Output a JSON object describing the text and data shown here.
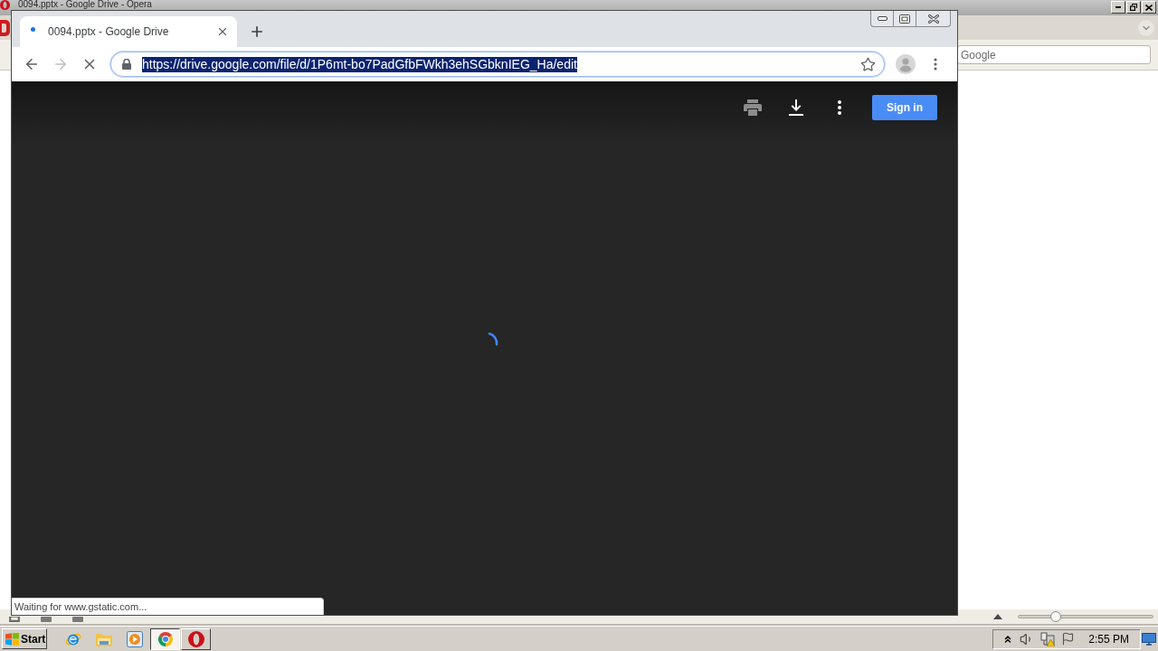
{
  "background_window": {
    "title": "0094.pptx - Google Drive - Opera",
    "search": {
      "placeholder": "Google"
    },
    "zoom": {
      "level": 0.28
    }
  },
  "browser": {
    "tabs": [
      {
        "title": "0094.pptx - Google Drive",
        "selected": true,
        "loading": true
      }
    ],
    "nav": [
      {
        "kind": "back",
        "disabled": false
      },
      {
        "kind": "forward",
        "disabled": true
      },
      {
        "kind": "stop",
        "disabled": false
      }
    ],
    "address_bar": {
      "url": "https://drive.google.com/file/d/1P6mt-bo7PadGfbFWkh3ehSGbknIEG_Ha/edit",
      "focused": true
    },
    "viewer": {
      "actions": [
        {
          "kind": "print",
          "disabled": true
        },
        {
          "kind": "download",
          "disabled": false
        },
        {
          "kind": "more",
          "disabled": false
        }
      ],
      "sign_in": "Sign in",
      "loading": true
    },
    "status": "Waiting for www.gstatic.com..."
  },
  "taskbar": {
    "start": "Start",
    "apps": [
      {
        "kind": "ie",
        "open": false,
        "selected": false
      },
      {
        "kind": "explorer",
        "open": false,
        "selected": false
      },
      {
        "kind": "media_player",
        "open": false,
        "selected": false
      },
      {
        "kind": "chrome",
        "open": true,
        "selected": true
      },
      {
        "kind": "opera",
        "open": true,
        "selected": false
      }
    ],
    "clock": "2:55 PM"
  }
}
